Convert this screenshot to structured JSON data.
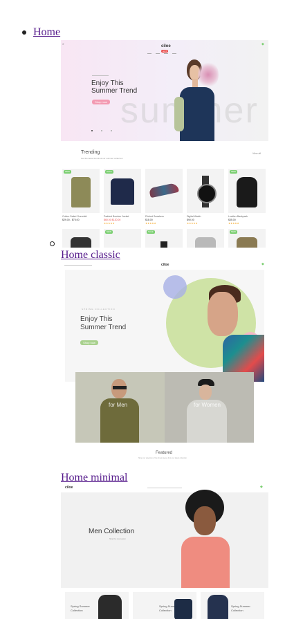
{
  "menu": {
    "items": [
      {
        "label": "Home"
      },
      {
        "label": "Home classic"
      },
      {
        "label": "Home minimal"
      }
    ]
  },
  "preview1": {
    "logo": "ciloe",
    "nav_badge": "HOT",
    "hero_title_line1": "Enjoy This",
    "hero_title_line2": "Summer Trend",
    "hero_button": "Shop now",
    "hero_bg_word": "summer",
    "section_title": "Trending",
    "section_subtitle": "Get the latest trends of our summer collection",
    "view_all": "View all",
    "products": [
      {
        "name": "Cotton Safari Overshirt",
        "price": "$29.00 - $75.00",
        "badge": "NEW"
      },
      {
        "name": "Padded Bomber Jacket",
        "price": "$60.00 $120.00",
        "badge": "SALE"
      },
      {
        "name": "Printed Sneakers",
        "price": "$18.00",
        "badge": ""
      },
      {
        "name": "Digital Watch",
        "price": "$90.00",
        "badge": ""
      },
      {
        "name": "Leather Backpack",
        "price": "$35.00",
        "badge": "NEW"
      }
    ],
    "row2_badges": [
      "NEW",
      "SALE",
      "NEW"
    ]
  },
  "preview2": {
    "logo": "ciloe",
    "hero_subtitle": "SPRING COLLECTION",
    "hero_title_line1": "Enjoy This",
    "hero_title_line2": "Summer Trend",
    "hero_button": "Shop now",
    "banner_men": "for Men",
    "banner_women": "for Women",
    "featured_title": "Featured",
    "featured_subtitle": "Shop our selection of the finest pieces from our latest collection"
  },
  "preview3": {
    "logo": "ciloe",
    "hero_title": "Men Collection",
    "hero_subtitle": "Shop the new season",
    "tiles": [
      {
        "line1": "Spring Summer",
        "line2": "Collection"
      },
      {
        "line1": "Spring Summer",
        "line2": "Collection"
      },
      {
        "line1": "Spring Summer",
        "line2": "Collection"
      }
    ]
  },
  "colors": {
    "link": "#551a8b",
    "accent_pink": "#f39ab2",
    "accent_green": "#7ccf72",
    "hero_pink_bg": "#f7e3f0",
    "hero_green_circle": "#cfe3a6"
  }
}
